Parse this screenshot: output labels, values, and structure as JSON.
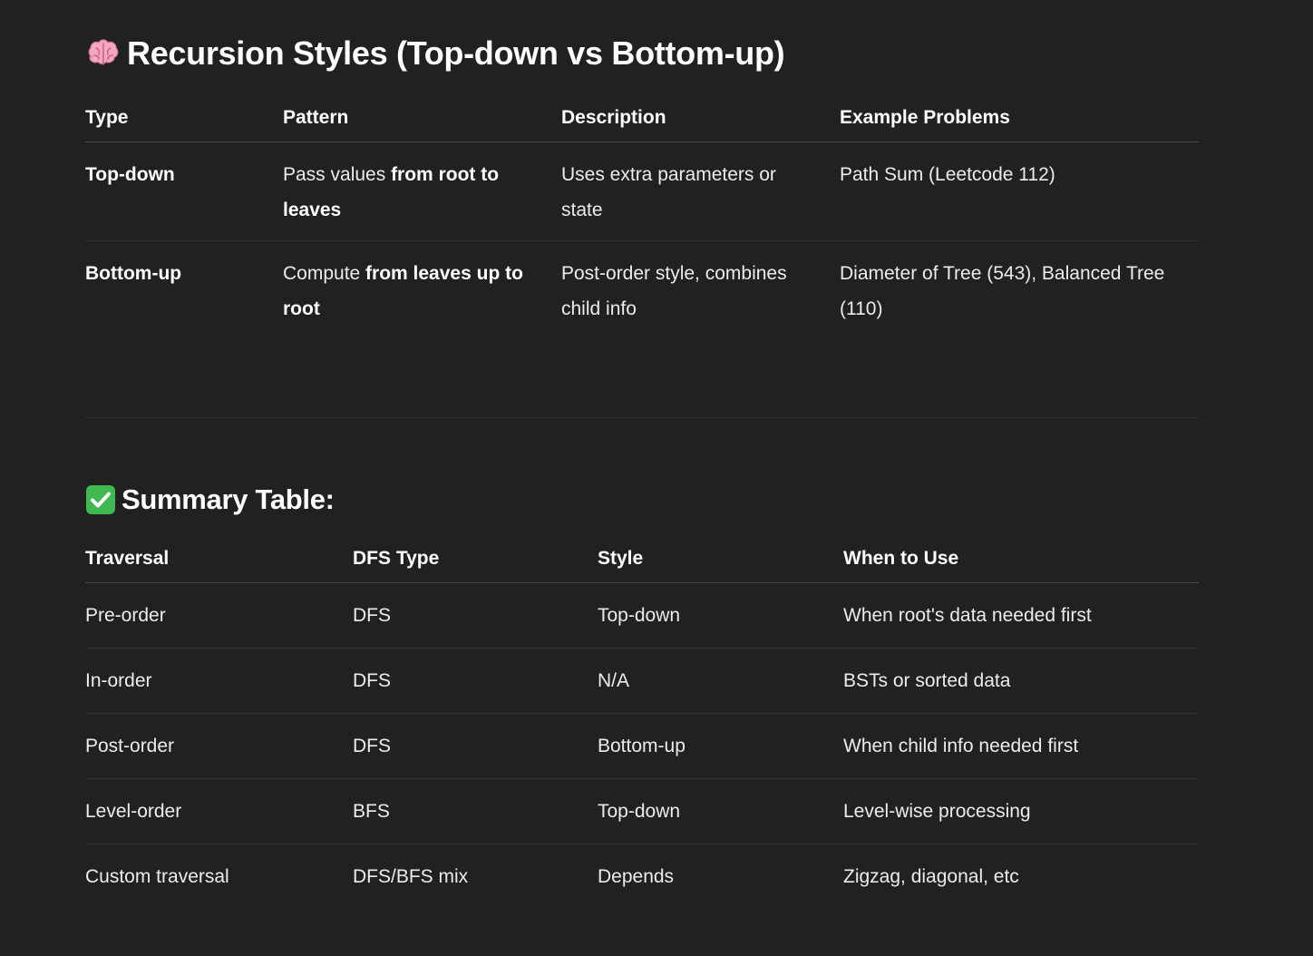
{
  "section1": {
    "emoji": "brain-icon",
    "title": "Recursion Styles (Top-down vs Bottom-up)",
    "headers": [
      "Type",
      "Pattern",
      "Description",
      "Example Problems"
    ],
    "rows": [
      {
        "type": "Top-down",
        "pattern_pre": "Pass values ",
        "pattern_bold": "from root to leaves",
        "description": "Uses extra parameters or state",
        "example": "Path Sum (Leetcode 112)"
      },
      {
        "type": "Bottom-up",
        "pattern_pre": "Compute ",
        "pattern_bold": "from leaves up to root",
        "description": "Post-order style, combines child info",
        "example": "Diameter of Tree (543), Balanced Tree (110)"
      }
    ]
  },
  "section2": {
    "emoji": "check-mark-icon",
    "title": "Summary Table:",
    "headers": [
      "Traversal",
      "DFS Type",
      "Style",
      "When to Use"
    ],
    "rows": [
      [
        "Pre-order",
        "DFS",
        "Top-down",
        "When root's data needed first"
      ],
      [
        "In-order",
        "DFS",
        "N/A",
        "BSTs or sorted data"
      ],
      [
        "Post-order",
        "DFS",
        "Bottom-up",
        "When child info needed first"
      ],
      [
        "Level-order",
        "BFS",
        "Top-down",
        "Level-wise processing"
      ],
      [
        "Custom traversal",
        "DFS/BFS mix",
        "Depends",
        "Zigzag, diagonal, etc"
      ]
    ]
  },
  "colors": {
    "background": "#212121",
    "text": "#ececec",
    "check_green": "#3fb950",
    "brain_pink": "#f4a7c0"
  }
}
